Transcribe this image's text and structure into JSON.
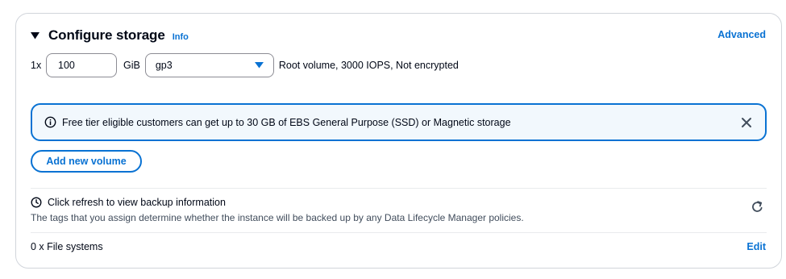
{
  "section": {
    "title": "Configure storage",
    "info_label": "Info",
    "advanced_label": "Advanced"
  },
  "volume": {
    "multiplier": "1x",
    "size_value": "100",
    "unit": "GiB",
    "type_selected": "gp3",
    "description": "Root volume,  3000 IOPS,  Not encrypted"
  },
  "alert": {
    "message": "Free tier eligible customers can get up to 30 GB of EBS General Purpose (SSD) or Magnetic storage"
  },
  "add_volume_label": "Add new volume",
  "backup": {
    "title": "Click refresh to view backup information",
    "description": "The tags that you assign determine whether the instance will be backed up by any Data Lifecycle Manager policies."
  },
  "file_systems": {
    "label": "0 x File systems",
    "edit_label": "Edit"
  },
  "colors": {
    "link": "#0972d3",
    "alert_bg": "#f2f8fd",
    "border": "#d1d5db"
  },
  "icons": [
    "caret-down-icon",
    "select-arrow-icon",
    "info-circle-icon",
    "close-icon",
    "clock-icon",
    "refresh-icon"
  ]
}
